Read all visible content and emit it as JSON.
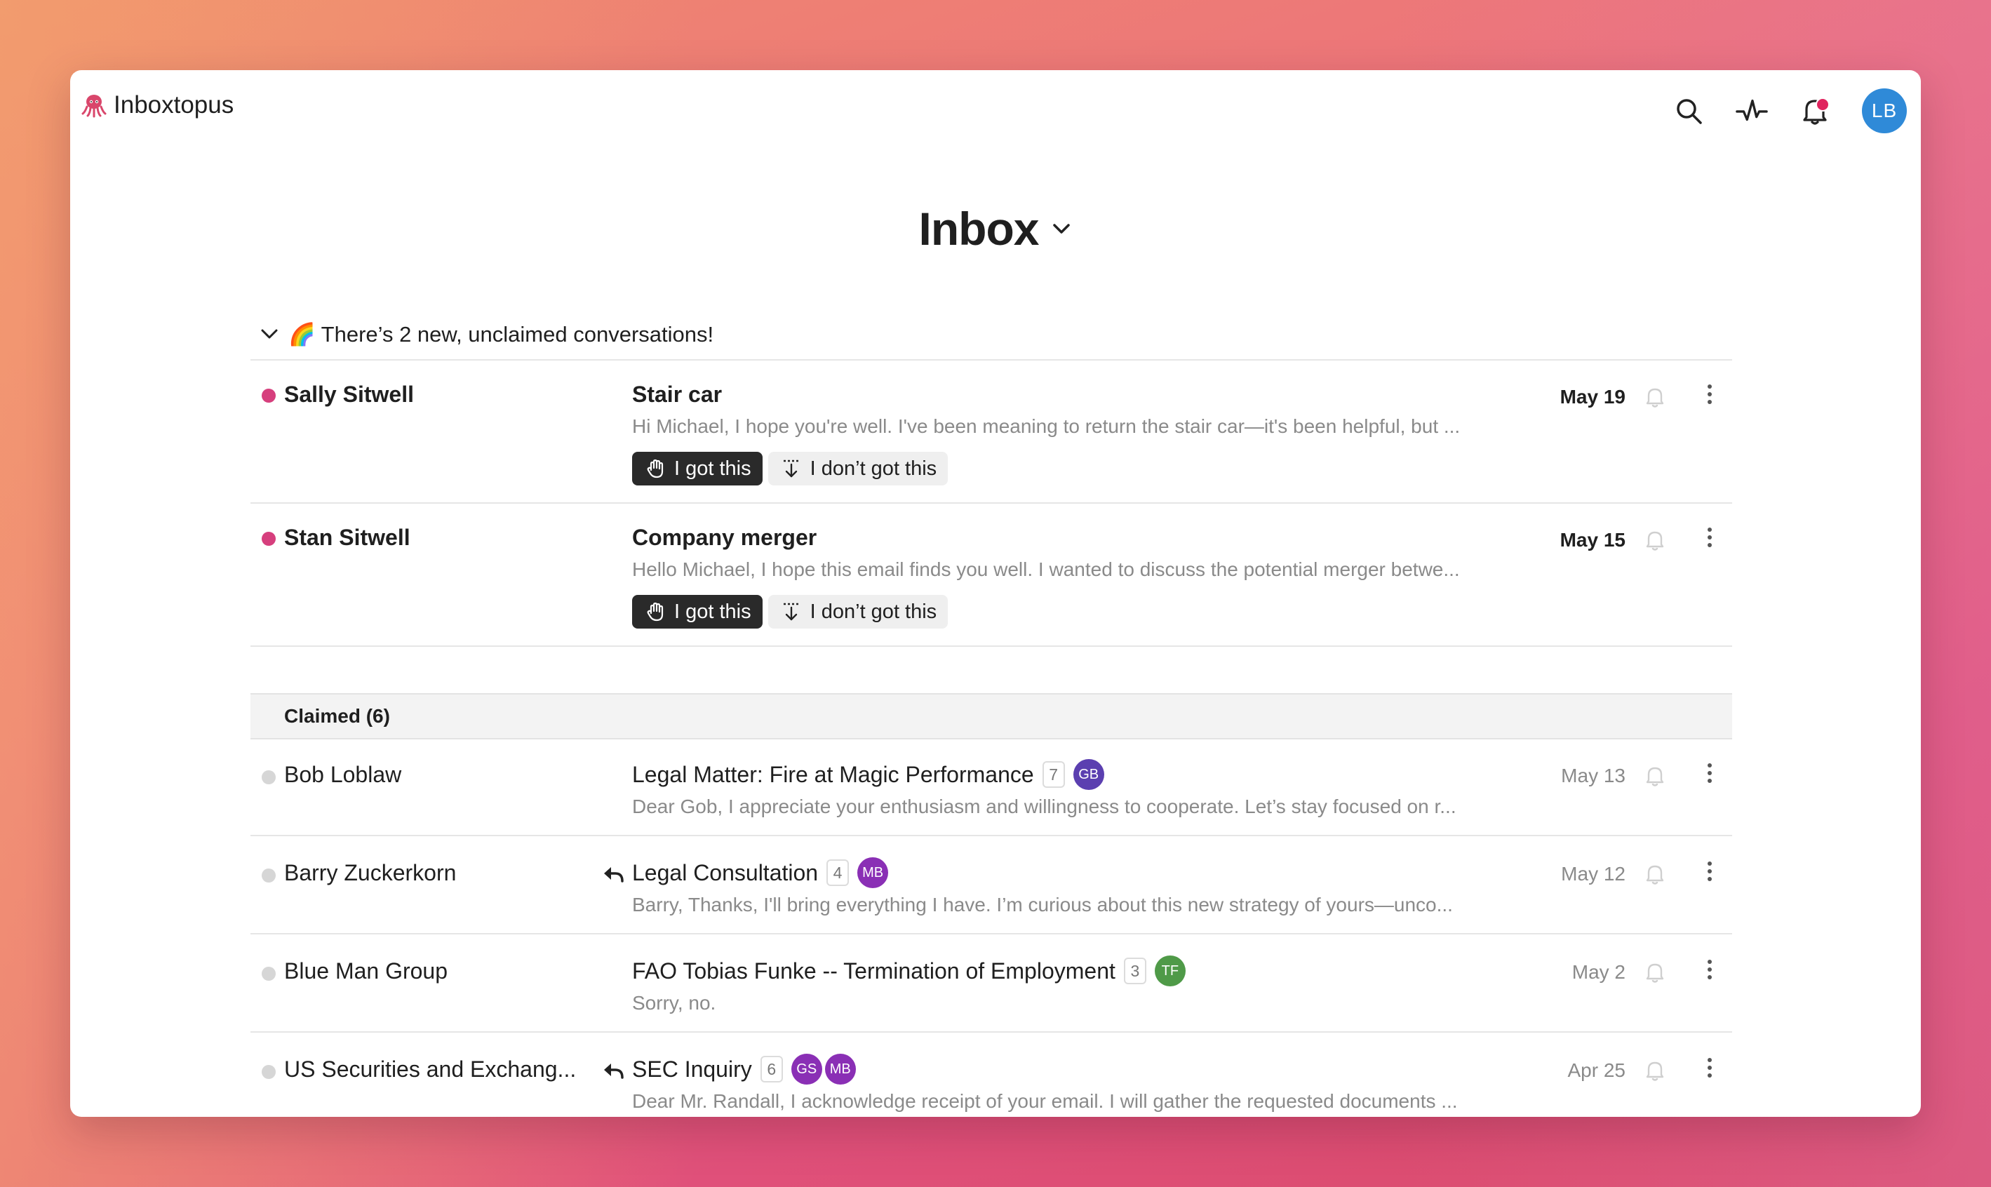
{
  "app": {
    "name": "Inboxtopus",
    "user_initials": "LB"
  },
  "header": {
    "title": "Inbox"
  },
  "new_section": {
    "label": "🌈 There’s 2 new, unclaimed conversations!"
  },
  "actions": {
    "claim": "I got this",
    "decline": "I don’t got this"
  },
  "new_conversations": [
    {
      "sender": "Sally Sitwell",
      "subject": "Stair car",
      "snippet": "Hi Michael, I hope you're well. I've been meaning to return the stair car—it's been helpful, but ...",
      "date": "May 19"
    },
    {
      "sender": "Stan Sitwell",
      "subject": "Company merger",
      "snippet": "Hello Michael, I hope this email finds you well. I wanted to discuss the potential merger betwe...",
      "date": "May 15"
    }
  ],
  "claimed": {
    "label": "Claimed (6)",
    "items": [
      {
        "sender": "Bob Loblaw",
        "replied": false,
        "subject": "Legal Matter: Fire at Magic Performance",
        "count": "7",
        "assignees": [
          {
            "initials": "GB",
            "color": "#5b3fb0"
          }
        ],
        "snippet": "Dear Gob, I appreciate your enthusiasm and willingness to cooperate. Let’s stay focused on r...",
        "date": "May 13"
      },
      {
        "sender": "Barry Zuckerkorn",
        "replied": true,
        "subject": "Legal Consultation",
        "count": "4",
        "assignees": [
          {
            "initials": "MB",
            "color": "#8a2fb5"
          }
        ],
        "snippet": "Barry, Thanks, I'll bring everything I have. I’m curious about this new strategy of yours—unco...",
        "date": "May 12"
      },
      {
        "sender": "Blue Man Group",
        "replied": false,
        "subject": "FAO Tobias Funke -- Termination of Employment",
        "count": "3",
        "assignees": [
          {
            "initials": "TF",
            "color": "#4f9a48"
          }
        ],
        "snippet": "Sorry, no.",
        "date": "May 2"
      },
      {
        "sender": "US Securities and Exchang...",
        "replied": true,
        "subject": "SEC Inquiry",
        "count": "6",
        "assignees": [
          {
            "initials": "GS",
            "color": "#8a2fb5"
          },
          {
            "initials": "MB",
            "color": "#8a2fb5"
          }
        ],
        "snippet": "Dear Mr. Randall, I acknowledge receipt of your email. I will gather the requested documents ...",
        "date": "Apr 25"
      }
    ]
  }
}
